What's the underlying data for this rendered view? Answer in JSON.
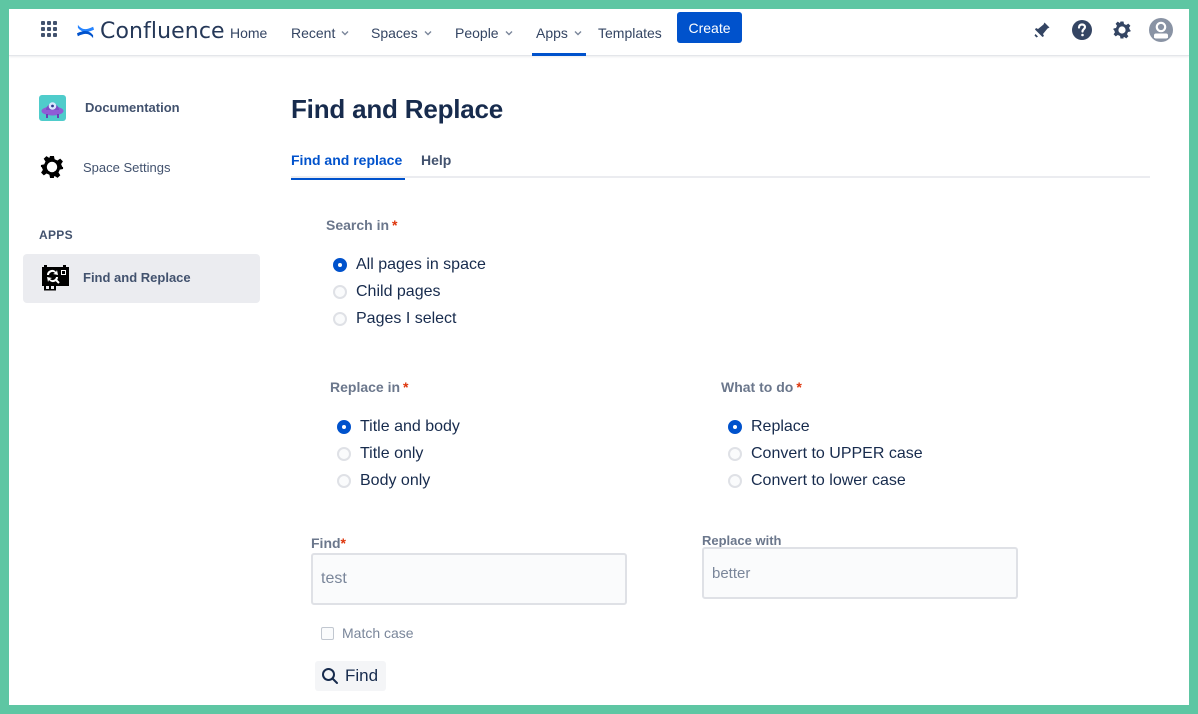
{
  "nav": {
    "brand": "Confluence",
    "items": [
      {
        "label": "Home",
        "dropdown": false,
        "active": false
      },
      {
        "label": "Recent",
        "dropdown": true,
        "active": false
      },
      {
        "label": "Spaces",
        "dropdown": true,
        "active": false
      },
      {
        "label": "People",
        "dropdown": true,
        "active": false
      },
      {
        "label": "Apps",
        "dropdown": true,
        "active": true
      },
      {
        "label": "Templates",
        "dropdown": false,
        "active": false
      }
    ],
    "create_label": "Create",
    "right_icons": [
      "notifications-icon",
      "help-icon",
      "settings-icon",
      "profile-avatar-icon"
    ],
    "accent_color": "#0052cc"
  },
  "sidebar": {
    "space_name": "Documentation",
    "space_settings_label": "Space Settings",
    "apps_heading": "APPS",
    "apps": [
      {
        "label": "Find and Replace",
        "selected": true
      }
    ]
  },
  "main": {
    "title": "Find and Replace",
    "tabs": [
      {
        "label": "Find and replace",
        "active": true
      },
      {
        "label": "Help",
        "active": false
      }
    ],
    "search_in": {
      "label": "Search in",
      "required": "*",
      "options": [
        {
          "label": "All pages in space",
          "checked": true
        },
        {
          "label": "Child pages",
          "checked": false
        },
        {
          "label": "Pages I select",
          "checked": false
        }
      ]
    },
    "replace_in": {
      "label": "Replace in",
      "required": "*",
      "options": [
        {
          "label": "Title and body",
          "checked": true
        },
        {
          "label": "Title only",
          "checked": false
        },
        {
          "label": "Body only",
          "checked": false
        }
      ]
    },
    "what_to_do": {
      "label": "What to do",
      "required": "*",
      "options": [
        {
          "label": "Replace",
          "checked": true
        },
        {
          "label": "Convert to UPPER case",
          "checked": false
        },
        {
          "label": "Convert to lower case",
          "checked": false
        }
      ]
    },
    "find": {
      "label": "Find",
      "required": "*",
      "value": "test",
      "match_case_label": "Match case",
      "match_case_checked": false,
      "button_label": "Find"
    },
    "replace_with": {
      "label": "Replace with",
      "value": "better"
    }
  }
}
